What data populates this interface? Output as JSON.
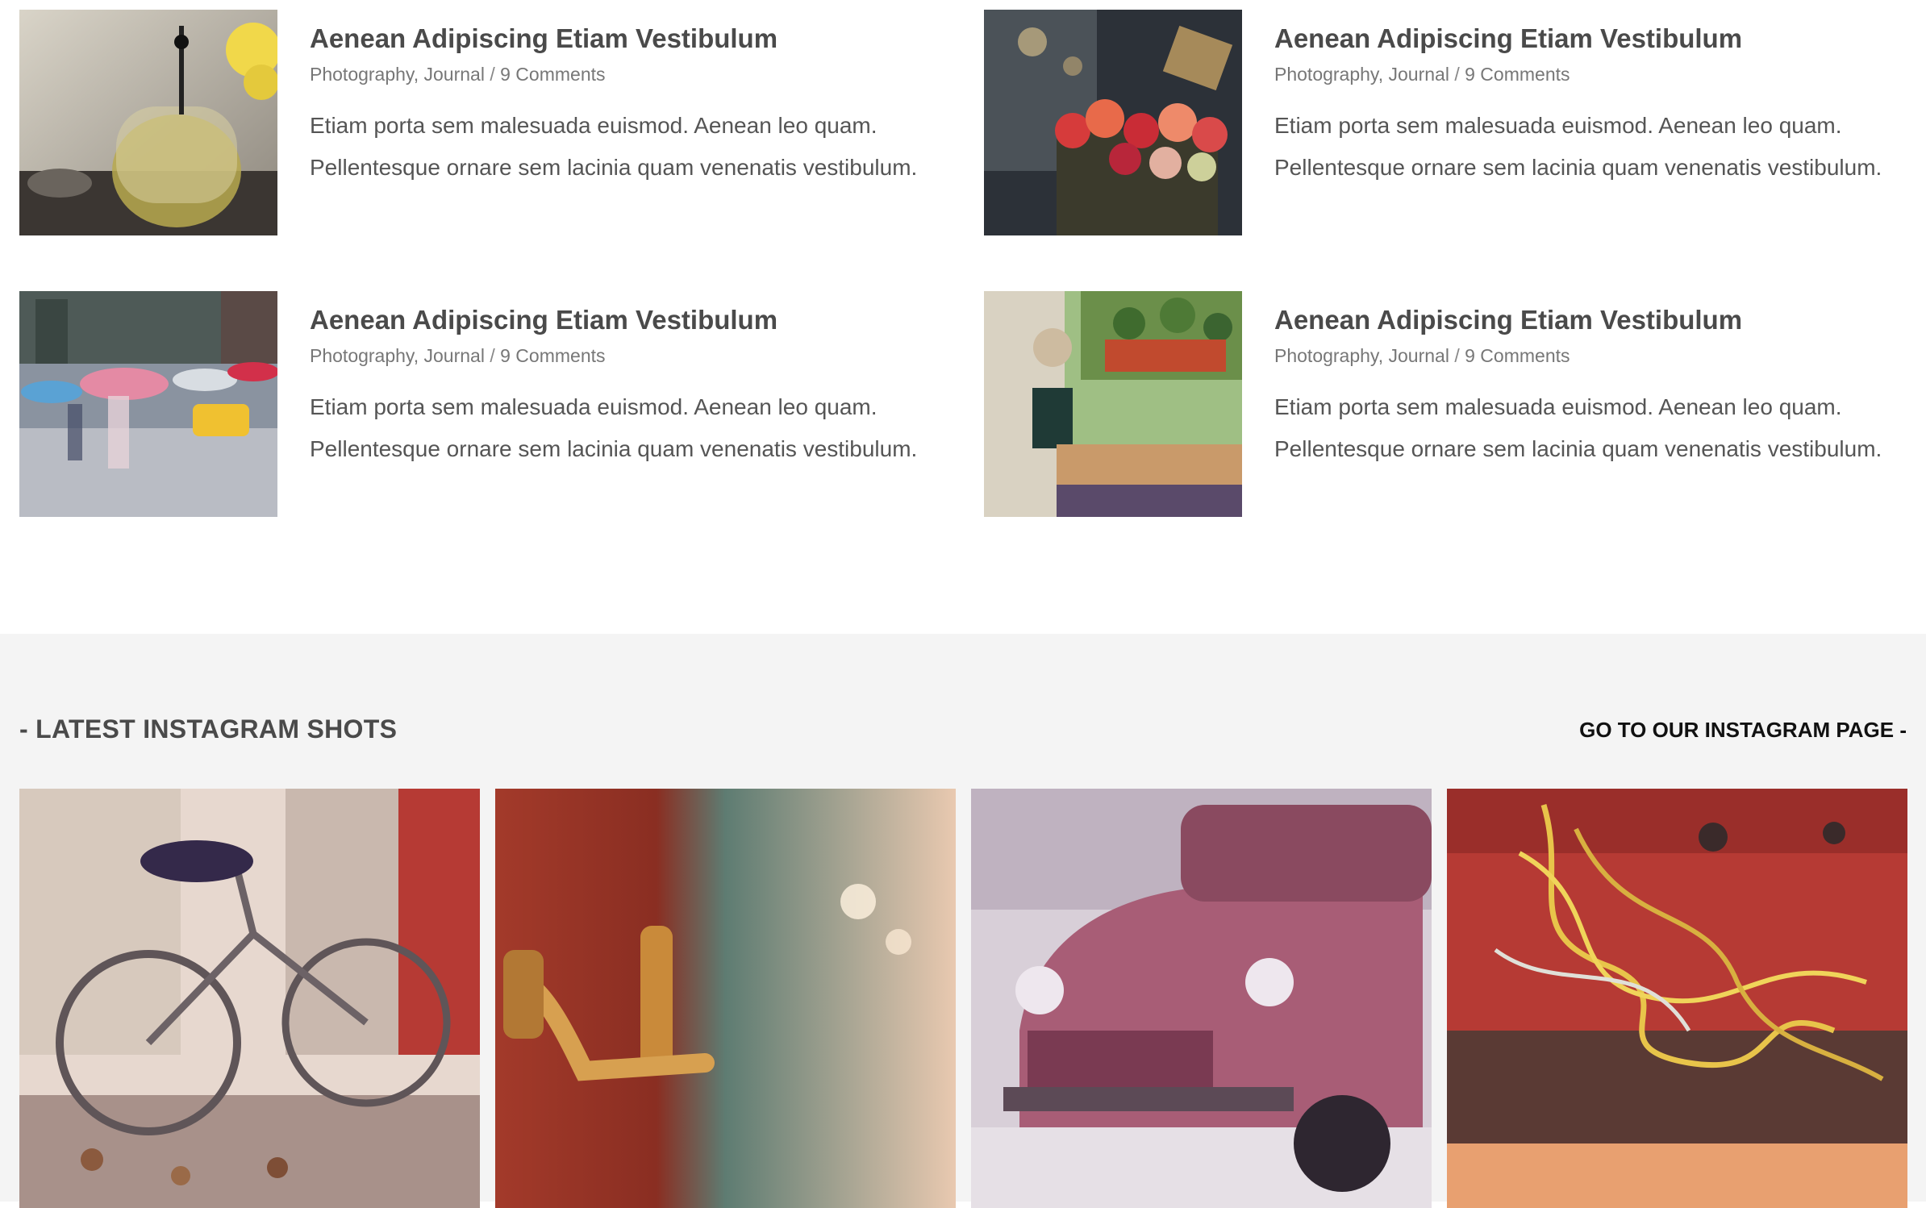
{
  "posts": [
    {
      "title": "Aenean Adipiscing Etiam Vestibulum",
      "categories": "Photography, Journal",
      "separator": "/",
      "comments": "9 Comments",
      "excerpt": "Etiam porta sem malesuada euismod. Aenean leo quam. Pellentesque ornare sem lacinia quam venenatis vestibulum.",
      "image": "teapot-photo"
    },
    {
      "title": "Aenean Adipiscing Etiam Vestibulum",
      "categories": "Photography, Journal",
      "separator": "/",
      "comments": "9 Comments",
      "excerpt": "Etiam porta sem malesuada euismod. Aenean leo quam. Pellentesque ornare sem lacinia quam venenatis vestibulum.",
      "image": "roses-photo"
    },
    {
      "title": "Aenean Adipiscing Etiam Vestibulum",
      "categories": "Photography, Journal",
      "separator": "/",
      "comments": "9 Comments",
      "excerpt": "Etiam porta sem malesuada euismod. Aenean leo quam. Pellentesque ornare sem lacinia quam venenatis vestibulum.",
      "image": "umbrellas-street-photo"
    },
    {
      "title": "Aenean Adipiscing Etiam Vestibulum",
      "categories": "Photography, Journal",
      "separator": "/",
      "comments": "9 Comments",
      "excerpt": "Etiam porta sem malesuada euismod. Aenean leo quam. Pellentesque ornare sem lacinia quam venenatis vestibulum.",
      "image": "cafe-table-photo"
    }
  ],
  "instagram": {
    "title": "- LATEST INSTAGRAM SHOTS",
    "link_label": "GO TO OUR INSTAGRAM PAGE -",
    "shots": [
      "bicycle-photo",
      "door-handle-photo",
      "old-truck-photo",
      "wires-photo"
    ]
  },
  "colors": {
    "section_background": "#f4f4f4",
    "title": "#4a4a4a",
    "meta": "#777777",
    "link": "#111111"
  }
}
